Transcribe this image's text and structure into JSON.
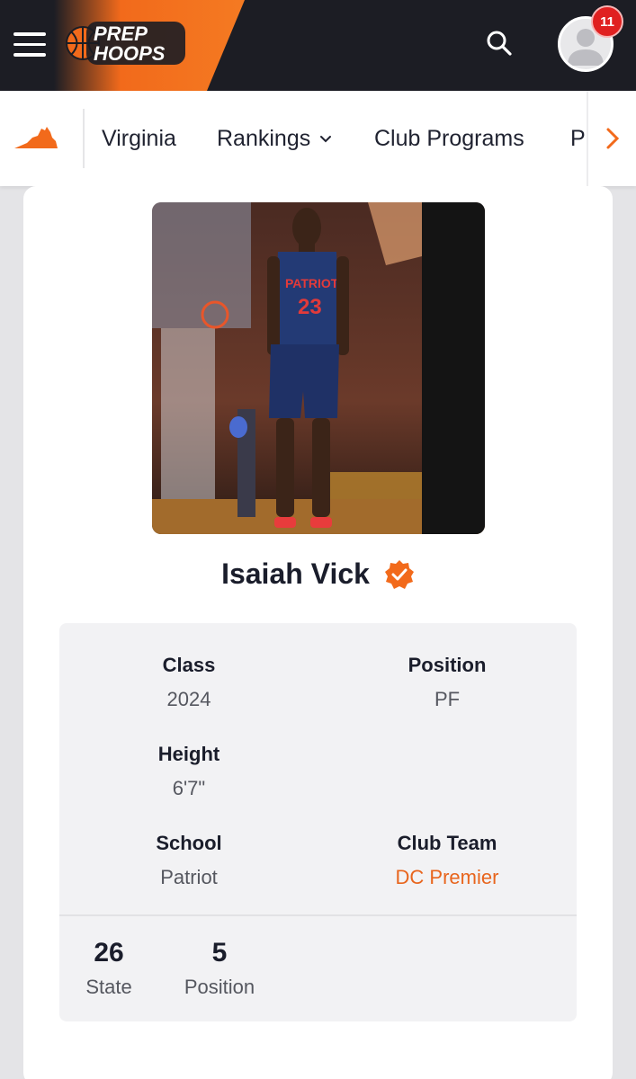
{
  "header": {
    "logo_line1": "PREP",
    "logo_line2": "HOOPS",
    "notification_count": "11",
    "brand_color": "#f26a1b",
    "bar_color": "#1c1d24"
  },
  "subnav": {
    "items": [
      {
        "label": "Virginia"
      },
      {
        "label": "Rankings"
      },
      {
        "label": "Club Programs"
      },
      {
        "label": "Pl"
      }
    ],
    "state_icon": "virginia-state-icon"
  },
  "player": {
    "name": "Isaiah Vick",
    "jersey_text": "PATRIOT",
    "jersey_number": "23",
    "verified_icon": "verified-check-icon"
  },
  "profile": {
    "class_label": "Class",
    "class_value": "2024",
    "position_label": "Position",
    "position_value": "PF",
    "height_label": "Height",
    "height_value": "6'7\"",
    "school_label": "School",
    "school_value": "Patriot",
    "club_label": "Club Team",
    "club_value": "DC Premier"
  },
  "rankings": [
    {
      "value": "26",
      "label": "State"
    },
    {
      "value": "5",
      "label": "Position"
    }
  ]
}
